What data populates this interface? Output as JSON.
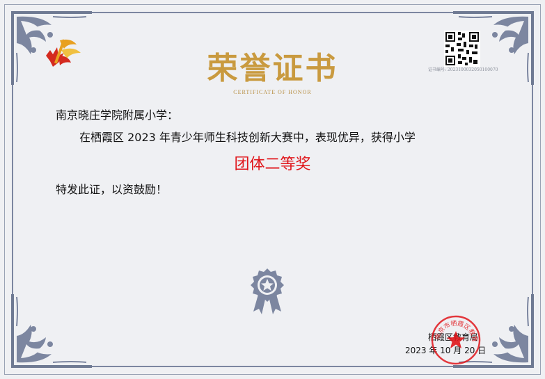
{
  "certificate": {
    "title": "荣誉证书",
    "subtitle": "CERTIFICATE OF HONOR",
    "cert_no": "证书编号: 2023100032050100070",
    "recipient": "南京晓庄学院附属小学：",
    "body_text": "在栖霞区 2023 年青少年师生科技创新大赛中，表现优异，获得小学",
    "award": "团体二等奖",
    "closing": "特发此证，以资鼓励！",
    "issuer": "栖霞区教育局",
    "date": "2023 年 10 月 20 日",
    "seal_text": "南京市栖霞区教育局"
  },
  "colors": {
    "title_gold": "#c99a3f",
    "award_red": "#e0161b",
    "frame_blue_gray": "#7c86a0",
    "seal_red": "#e0161b"
  },
  "icons": [
    "logo-icon",
    "qr-code-icon",
    "medal-icon",
    "seal-icon",
    "corner-ornament-icon"
  ]
}
